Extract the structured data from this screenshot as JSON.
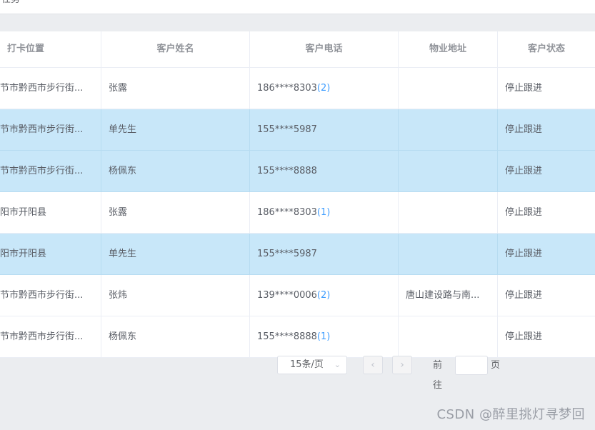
{
  "header": {
    "title": "任务"
  },
  "table": {
    "columns": [
      "打卡位置",
      "客户姓名",
      "客户电话",
      "物业地址",
      "客户状态"
    ],
    "rows": [
      {
        "location": "节市黔西市步行街...",
        "name": "张露",
        "phone": "186****8303",
        "count": "(2)",
        "address": "",
        "status": "停止跟进",
        "highlighted": false
      },
      {
        "location": "节市黔西市步行街...",
        "name": "单先生",
        "phone": "155****5987",
        "count": "",
        "address": "",
        "status": "停止跟进",
        "highlighted": true
      },
      {
        "location": "节市黔西市步行街...",
        "name": "杨佩东",
        "phone": "155****8888",
        "count": "",
        "address": "",
        "status": "停止跟进",
        "highlighted": true
      },
      {
        "location": "阳市开阳县",
        "name": "张露",
        "phone": "186****8303",
        "count": "(1)",
        "address": "",
        "status": "停止跟进",
        "highlighted": false
      },
      {
        "location": "阳市开阳县",
        "name": "单先生",
        "phone": "155****5987",
        "count": "",
        "address": "",
        "status": "停止跟进",
        "highlighted": true
      },
      {
        "location": "节市黔西市步行街...",
        "name": "张炜",
        "phone": "139****0006",
        "count": "(2)",
        "address": "唐山建设路与南...",
        "status": "停止跟进",
        "highlighted": false
      },
      {
        "location": "节市黔西市步行街...",
        "name": "杨佩东",
        "phone": "155****8888",
        "count": "(1)",
        "address": "",
        "status": "停止跟进",
        "highlighted": false
      }
    ]
  },
  "pagination": {
    "page_size_label": "15条/页",
    "prev_icon": "chevron-left-icon",
    "next_icon": "chevron-right-icon",
    "goto_label": "前往",
    "goto_value": "",
    "goto_suffix": "页"
  },
  "watermark": "CSDN @醉里挑灯寻梦回",
  "colors": {
    "highlight_row": "#c8e7f9",
    "link": "#409eff"
  }
}
